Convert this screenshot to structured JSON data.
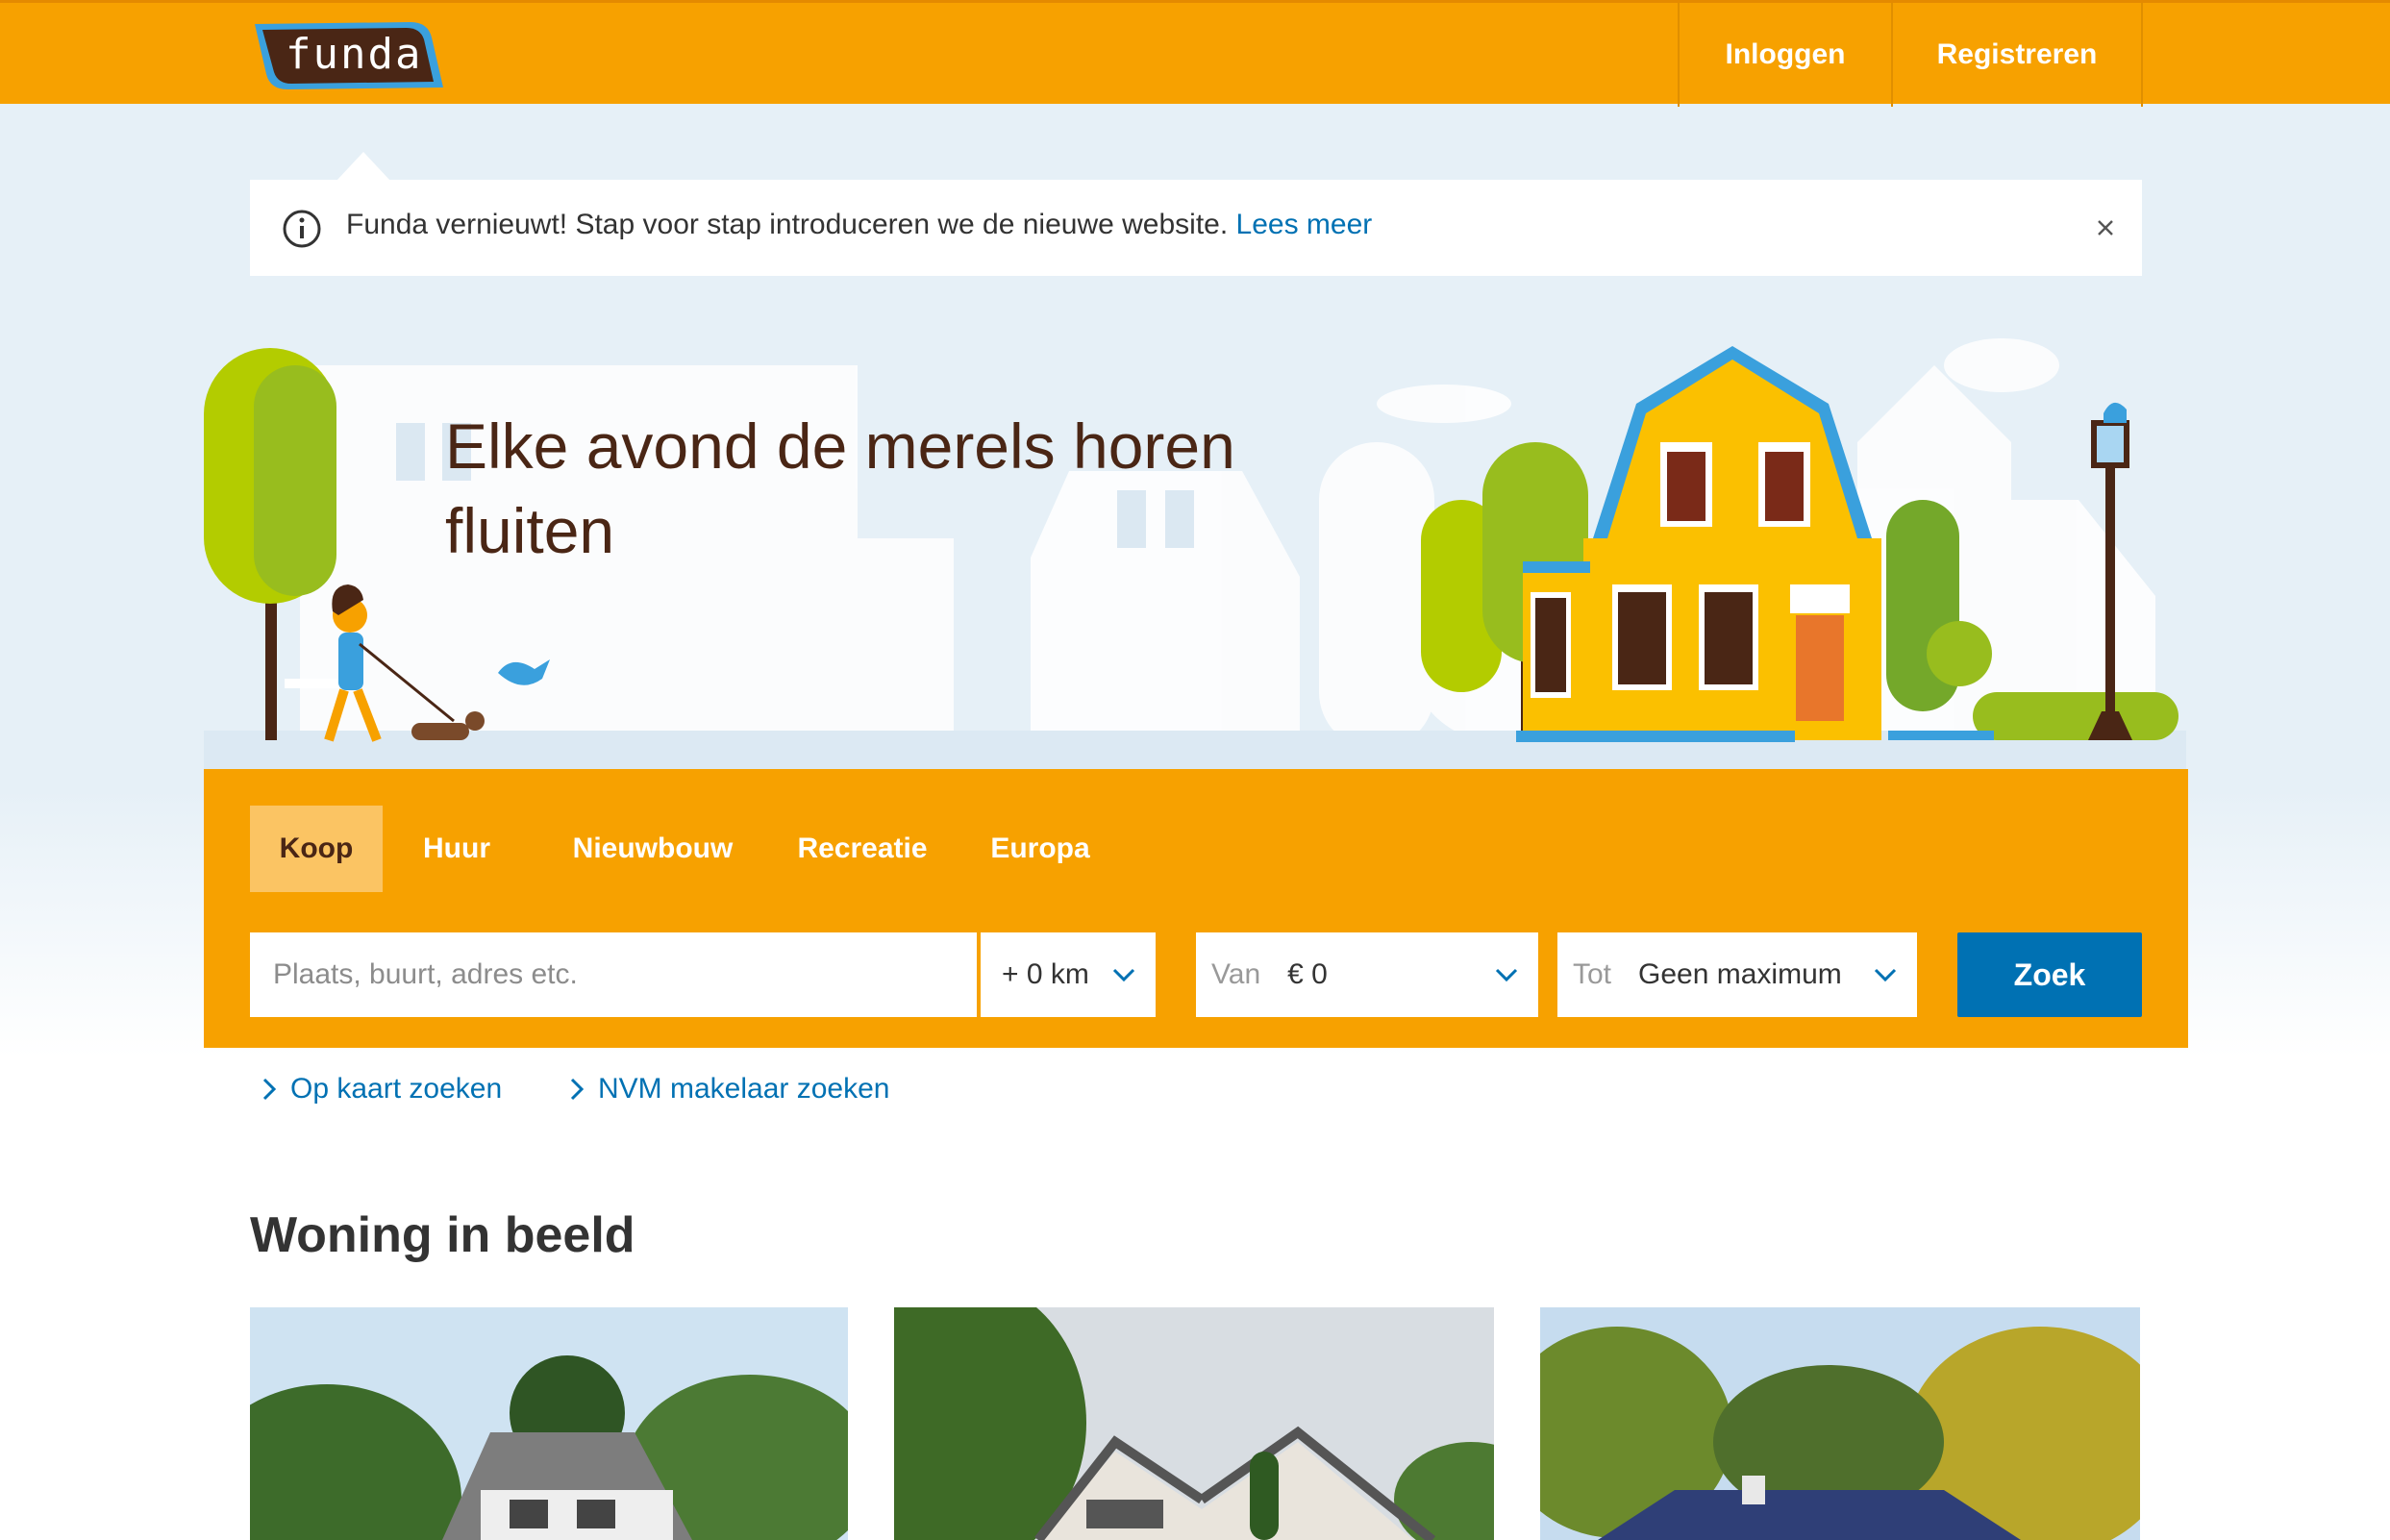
{
  "header": {
    "logo_text": "funda",
    "login_label": "Inloggen",
    "register_label": "Registreren"
  },
  "notice": {
    "text": "Funda vernieuwt! Stap voor stap introduceren we de nieuwe website.",
    "link_label": "Lees meer"
  },
  "hero": {
    "title": "Elke avond de merels horen fluiten"
  },
  "search": {
    "tabs": [
      {
        "label": "Koop",
        "active": true
      },
      {
        "label": "Huur",
        "active": false
      },
      {
        "label": "Nieuwbouw",
        "active": false
      },
      {
        "label": "Recreatie",
        "active": false
      },
      {
        "label": "Europa",
        "active": false
      }
    ],
    "location_placeholder": "Plaats, buurt, adres etc.",
    "location_value": "",
    "radius_value": "+ 0 km",
    "from_label": "Van",
    "from_value": "€ 0",
    "to_label": "Tot",
    "to_value": "Geen maximum",
    "submit_label": "Zoek"
  },
  "links": {
    "map_search": "Op kaart zoeken",
    "nvm_search": "NVM makelaar zoeken"
  },
  "section": {
    "title": "Woning in beeld"
  },
  "colors": {
    "brand_orange": "#f7a100",
    "active_tab": "#fbc463",
    "primary_blue": "#0071b3",
    "title_brown": "#4a2615",
    "sky": "#e6f0f7"
  }
}
